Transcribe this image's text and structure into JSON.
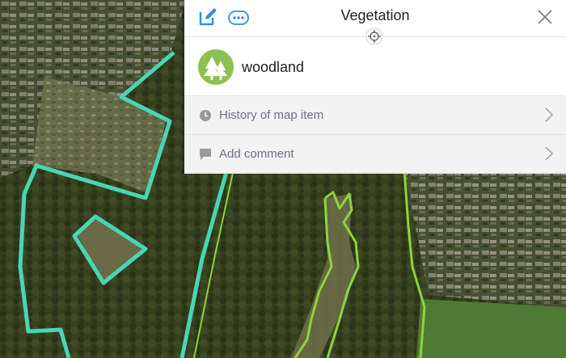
{
  "panel": {
    "title": "Vegetation",
    "item": {
      "label": "woodland",
      "icon": "tree-icon",
      "badge_color": "#8cc152"
    },
    "actions": [
      {
        "label": "History of map item",
        "icon": "clock-icon"
      },
      {
        "label": "Add comment",
        "icon": "comment-icon"
      }
    ],
    "toolbar": {
      "edit_icon": "edit-icon",
      "more_icon": "more-icon",
      "close_icon": "close-icon",
      "locate_icon": "crosshair-icon"
    }
  },
  "map": {
    "highlight_outline_color": "#49d6b2",
    "vegetation_outline_color": "#8fd33c"
  }
}
